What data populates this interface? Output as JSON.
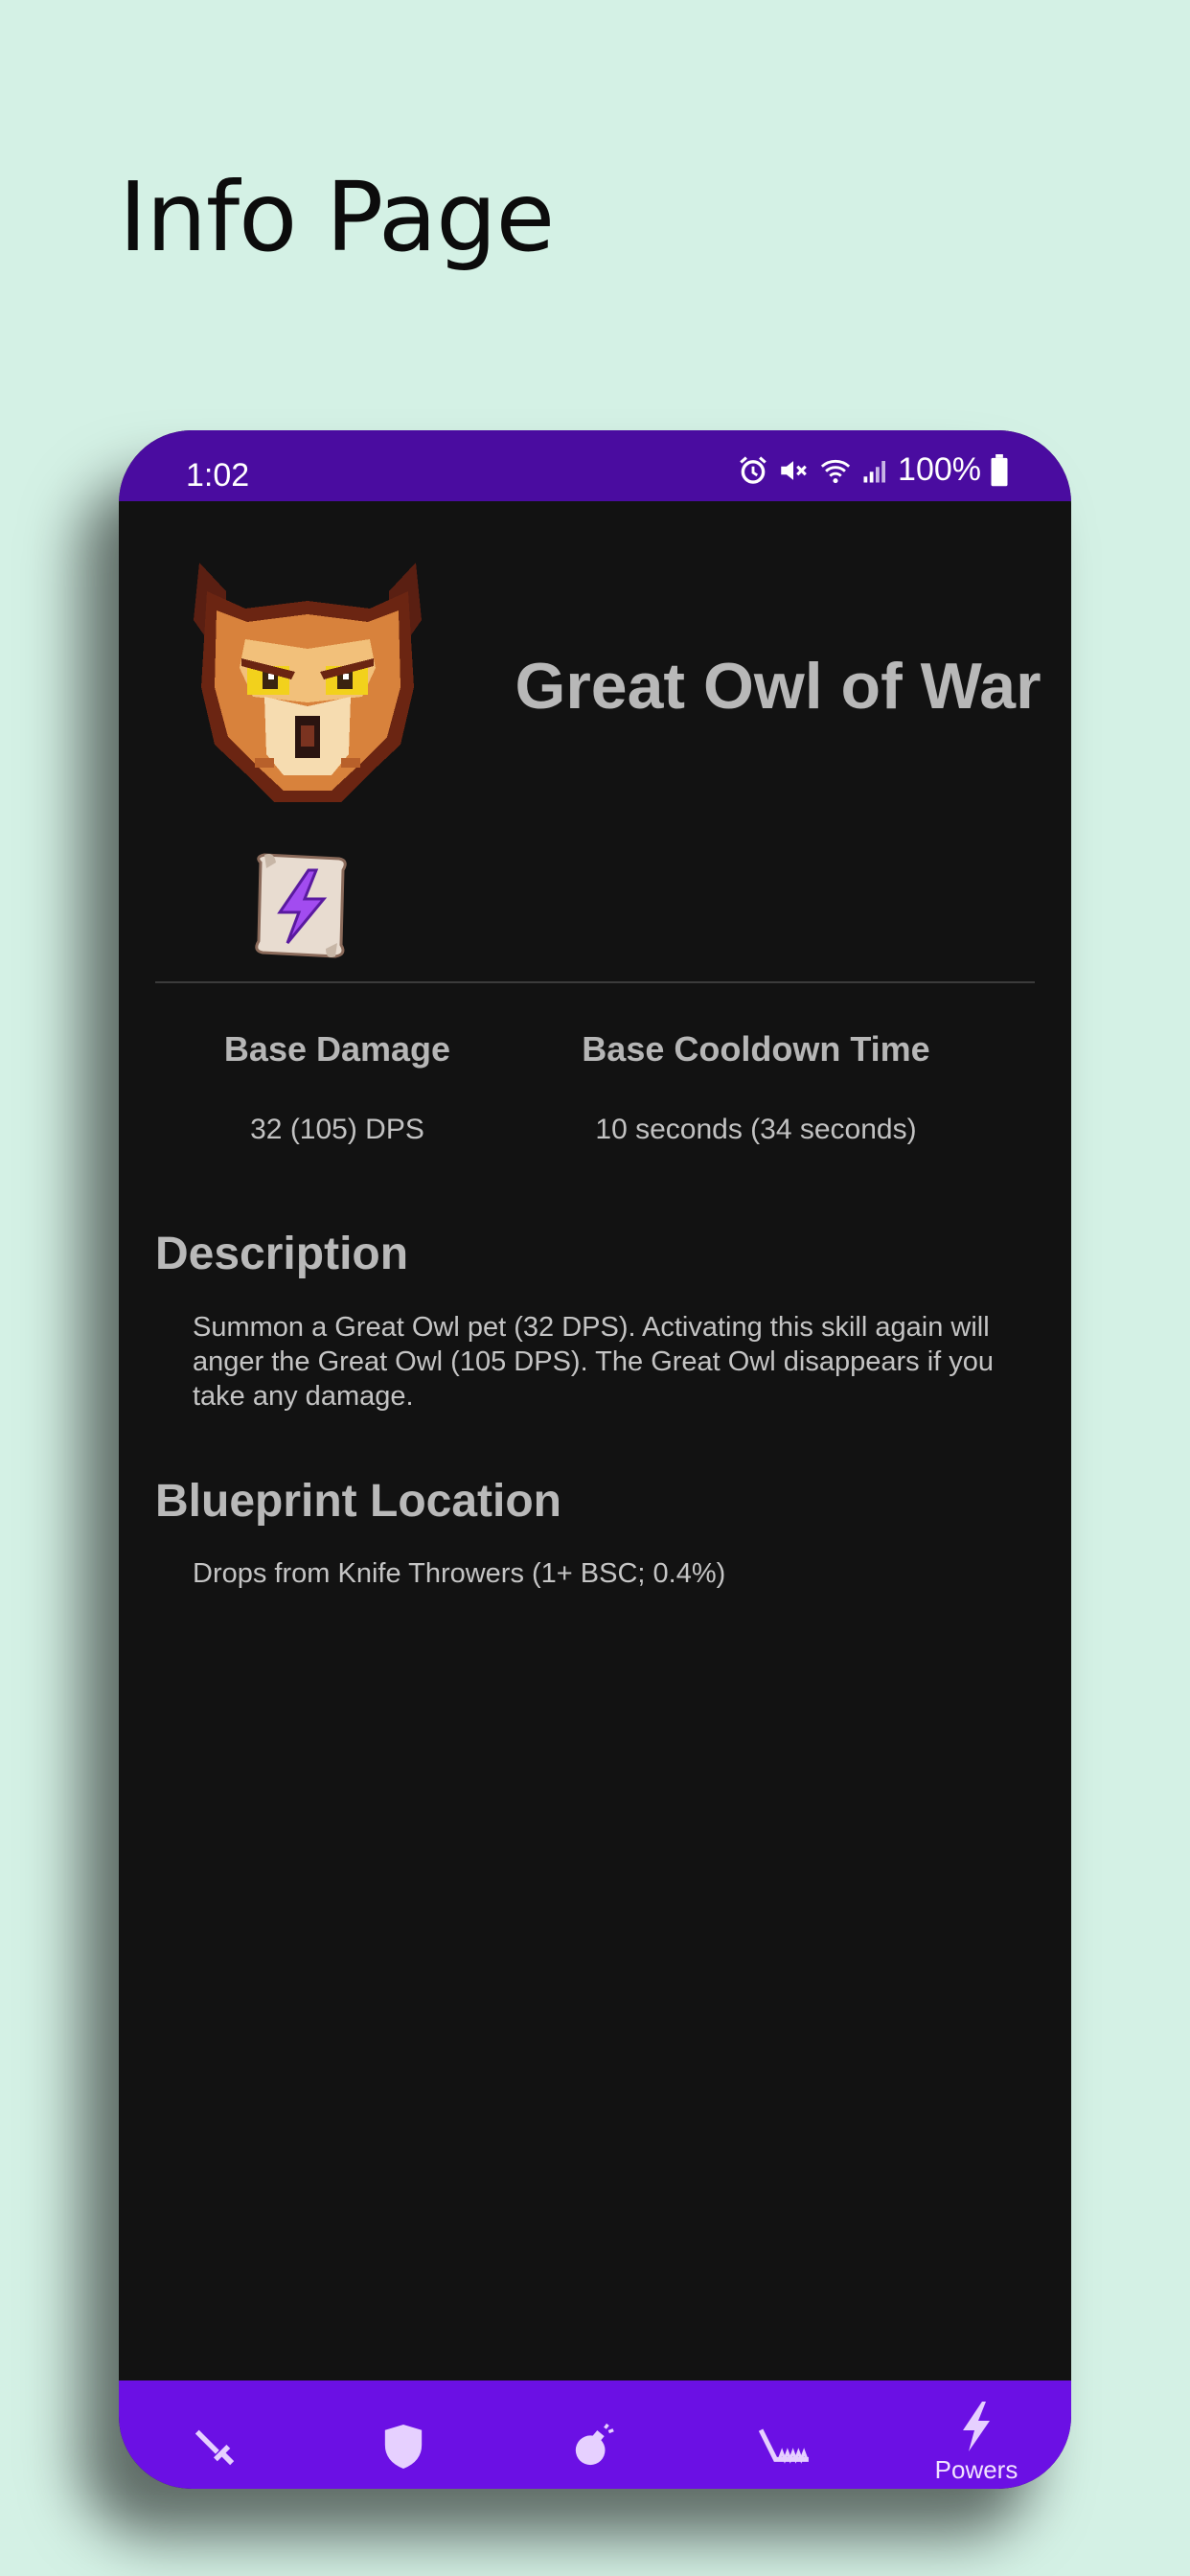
{
  "page_heading": "Info Page",
  "status": {
    "time": "1:02",
    "battery": "100%"
  },
  "item": {
    "title": "Great Owl of War",
    "owl_image": "great-owl-pixel-art",
    "type_icon": "power-scroll-icon"
  },
  "stats": {
    "damage_label": "Base Damage",
    "damage_value": "32 (105) DPS",
    "cooldown_label": "Base Cooldown Time",
    "cooldown_value": "10 seconds (34 seconds)"
  },
  "description": {
    "title": "Description",
    "text": "Summon a Great Owl pet (32 DPS). Activating this skill again will anger the Great Owl (105 DPS). The Great Owl disappears if you take any damage."
  },
  "blueprint": {
    "title": "Blueprint Location",
    "text": "Drops from Knife Throwers (1+ BSC; 0.4%)"
  },
  "nav": {
    "items": [
      {
        "icon": "sword-icon",
        "label": ""
      },
      {
        "icon": "shield-icon",
        "label": ""
      },
      {
        "icon": "bomb-icon",
        "label": ""
      },
      {
        "icon": "trap-icon",
        "label": ""
      },
      {
        "icon": "lightning-icon",
        "label": "Powers"
      }
    ],
    "active_index": 4
  },
  "colors": {
    "background": "#d4f1e5",
    "status_bar": "#4a0ca0",
    "nav_bar": "#6b10e4",
    "screen": "#121212"
  }
}
